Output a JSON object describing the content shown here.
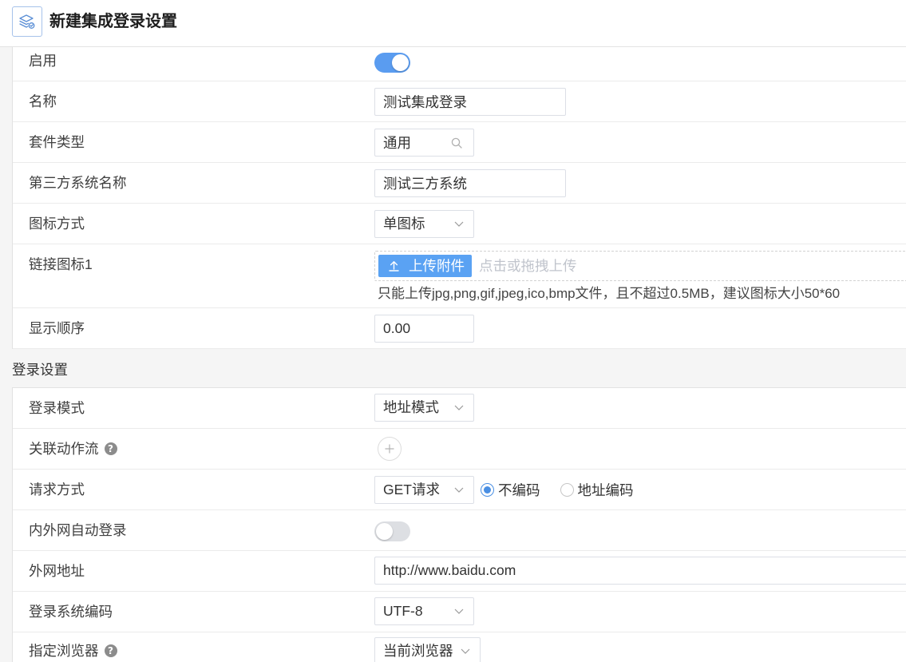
{
  "colors": {
    "accent": "#5a9cf0",
    "upload_button": "#5aa2f3",
    "radio_checked": "#4a8fe3",
    "help_icon": "#8c8c8c"
  },
  "header": {
    "icon": "layers-icon",
    "title": "新建集成登录设置"
  },
  "basic": {
    "enabled": {
      "label": "启用",
      "on": true
    },
    "name": {
      "label": "名称",
      "value": "测试集成登录"
    },
    "suite_type": {
      "label": "套件类型",
      "value": "通用",
      "icon": "search-icon"
    },
    "third_party_name": {
      "label": "第三方系统名称",
      "value": "测试三方系统"
    },
    "icon_mode": {
      "label": "图标方式",
      "value": "单图标"
    },
    "link_icon": {
      "label": "链接图标1",
      "upload_icon": "upload-icon",
      "upload_button": "上传附件",
      "drop_placeholder": "点击或拖拽上传",
      "hint": "只能上传jpg,png,gif,jpeg,ico,bmp文件，且不超过0.5MB，建议图标大小50*60"
    },
    "display_order": {
      "label": "显示顺序",
      "value": "0.00"
    }
  },
  "login": {
    "section_title": "登录设置",
    "login_mode": {
      "label": "登录模式",
      "value": "地址模式"
    },
    "linked_flow": {
      "label": "关联动作流",
      "help_icon": "question-icon",
      "add_icon": "plus-icon"
    },
    "request_method": {
      "label": "请求方式",
      "value": "GET请求",
      "options": [
        {
          "label": "不编码",
          "selected": true
        },
        {
          "label": "地址编码",
          "selected": false
        }
      ]
    },
    "auto_login": {
      "label": "内外网自动登录",
      "on": false
    },
    "external_url": {
      "label": "外网地址",
      "value": "http://www.baidu.com"
    },
    "encoding": {
      "label": "登录系统编码",
      "value": "UTF-8"
    },
    "browser": {
      "label": "指定浏览器",
      "help_icon": "question-icon",
      "value": "当前浏览器"
    }
  }
}
